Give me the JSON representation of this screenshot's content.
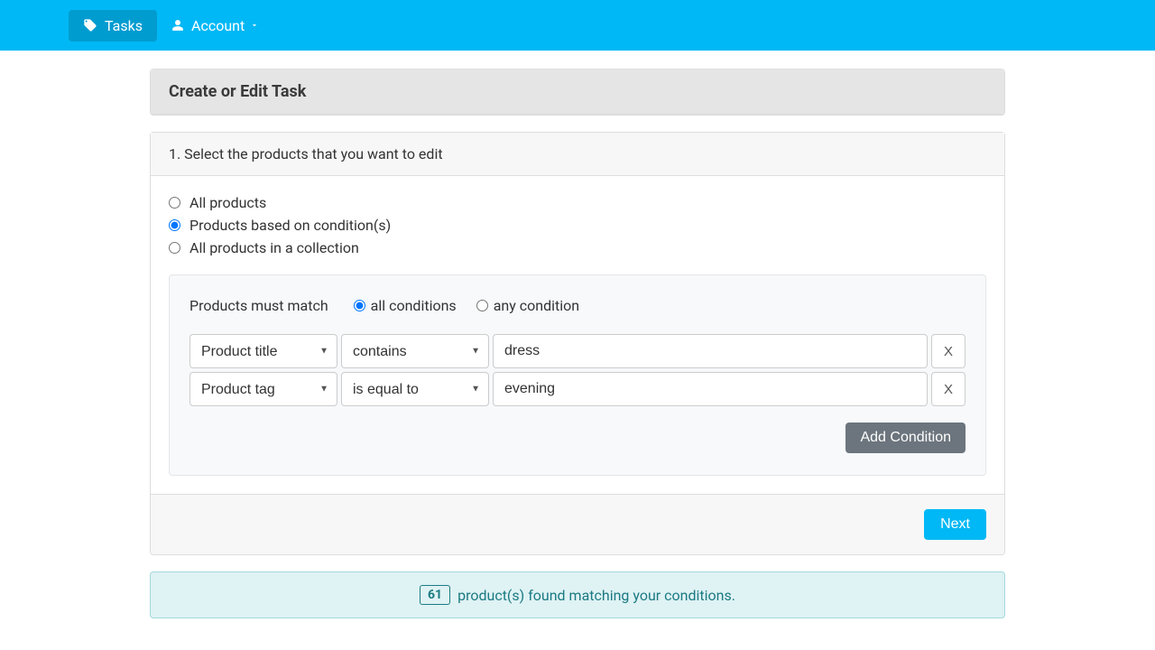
{
  "nav": {
    "tasks": "Tasks",
    "account": "Account"
  },
  "card_title": "Create or Edit Task",
  "step_title": "1. Select the products that you want to edit",
  "radios": {
    "all": "All products",
    "cond": "Products based on condition(s)",
    "collection": "All products in a collection"
  },
  "match": {
    "label": "Products must match",
    "all": "all conditions",
    "any": "any condition"
  },
  "rows": [
    {
      "field": "Product title",
      "op": "contains",
      "val": "dress",
      "remove": "X"
    },
    {
      "field": "Product tag",
      "op": "is equal to",
      "val": "evening",
      "remove": "X"
    }
  ],
  "add_label": "Add Condition",
  "next_label": "Next",
  "alert": {
    "count": "61",
    "text": "product(s) found matching your conditions."
  }
}
